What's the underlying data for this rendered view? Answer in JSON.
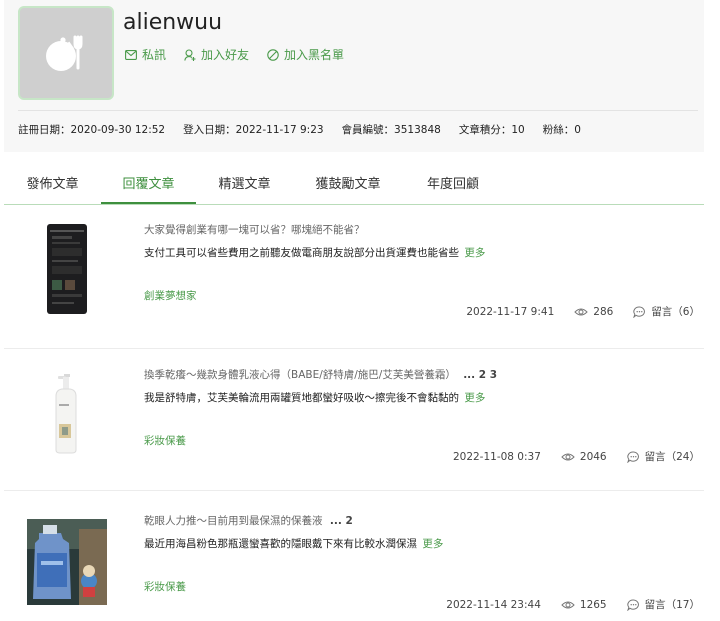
{
  "profile": {
    "username": "alienwuu",
    "actions": {
      "message": "私訊",
      "add_friend": "加入好友",
      "blacklist": "加入黑名單"
    },
    "stats": {
      "registered": "註冊日期：2020-09-30 12:52",
      "last_login": "登入日期：2022-11-17 9:23",
      "member_id": "會員編號：3513848",
      "article_points": "文章積分：10",
      "fans": "粉絲：0"
    }
  },
  "tabs": [
    {
      "label": "發佈文章"
    },
    {
      "label": "回覆文章"
    },
    {
      "label": "精選文章"
    },
    {
      "label": "獲鼓勵文章"
    },
    {
      "label": "年度回顧"
    }
  ],
  "articles": [
    {
      "title": "大家覺得創業有哪一塊可以省？哪塊絕不能省？",
      "pages": "",
      "excerpt": "支付工具可以省些費用之前聽友做電商朋友說部分出貨運費也能省些",
      "more": "更多",
      "category": "創業夢想家",
      "date": "2022-11-17 9:41",
      "views": "286",
      "comments": "留言（6）"
    },
    {
      "title": "換季乾癢～幾款身體乳液心得（BABE/舒特膚/施巴/艾芙美營養霜）",
      "pages": "... 2 3",
      "excerpt": "我是舒特膚，艾芙美輪流用兩罐質地都蠻好吸收～擦完後不會黏黏的",
      "more": "更多",
      "category": "彩妝保養",
      "date": "2022-11-08 0:37",
      "views": "2046",
      "comments": "留言（24）"
    },
    {
      "title": "乾眼人力推～目前用到最保濕的保養液",
      "pages": "... 2",
      "excerpt": "最近用海昌粉色那瓶還蠻喜歡的隱眼戴下來有比較水潤保濕",
      "more": "更多",
      "category": "彩妝保養",
      "date": "2022-11-14 23:44",
      "views": "1265",
      "comments": "留言（17）"
    }
  ],
  "colors": {
    "accent": "#3e8f3e",
    "link": "#4a9a4a",
    "header_bg": "#f7f7f7"
  }
}
